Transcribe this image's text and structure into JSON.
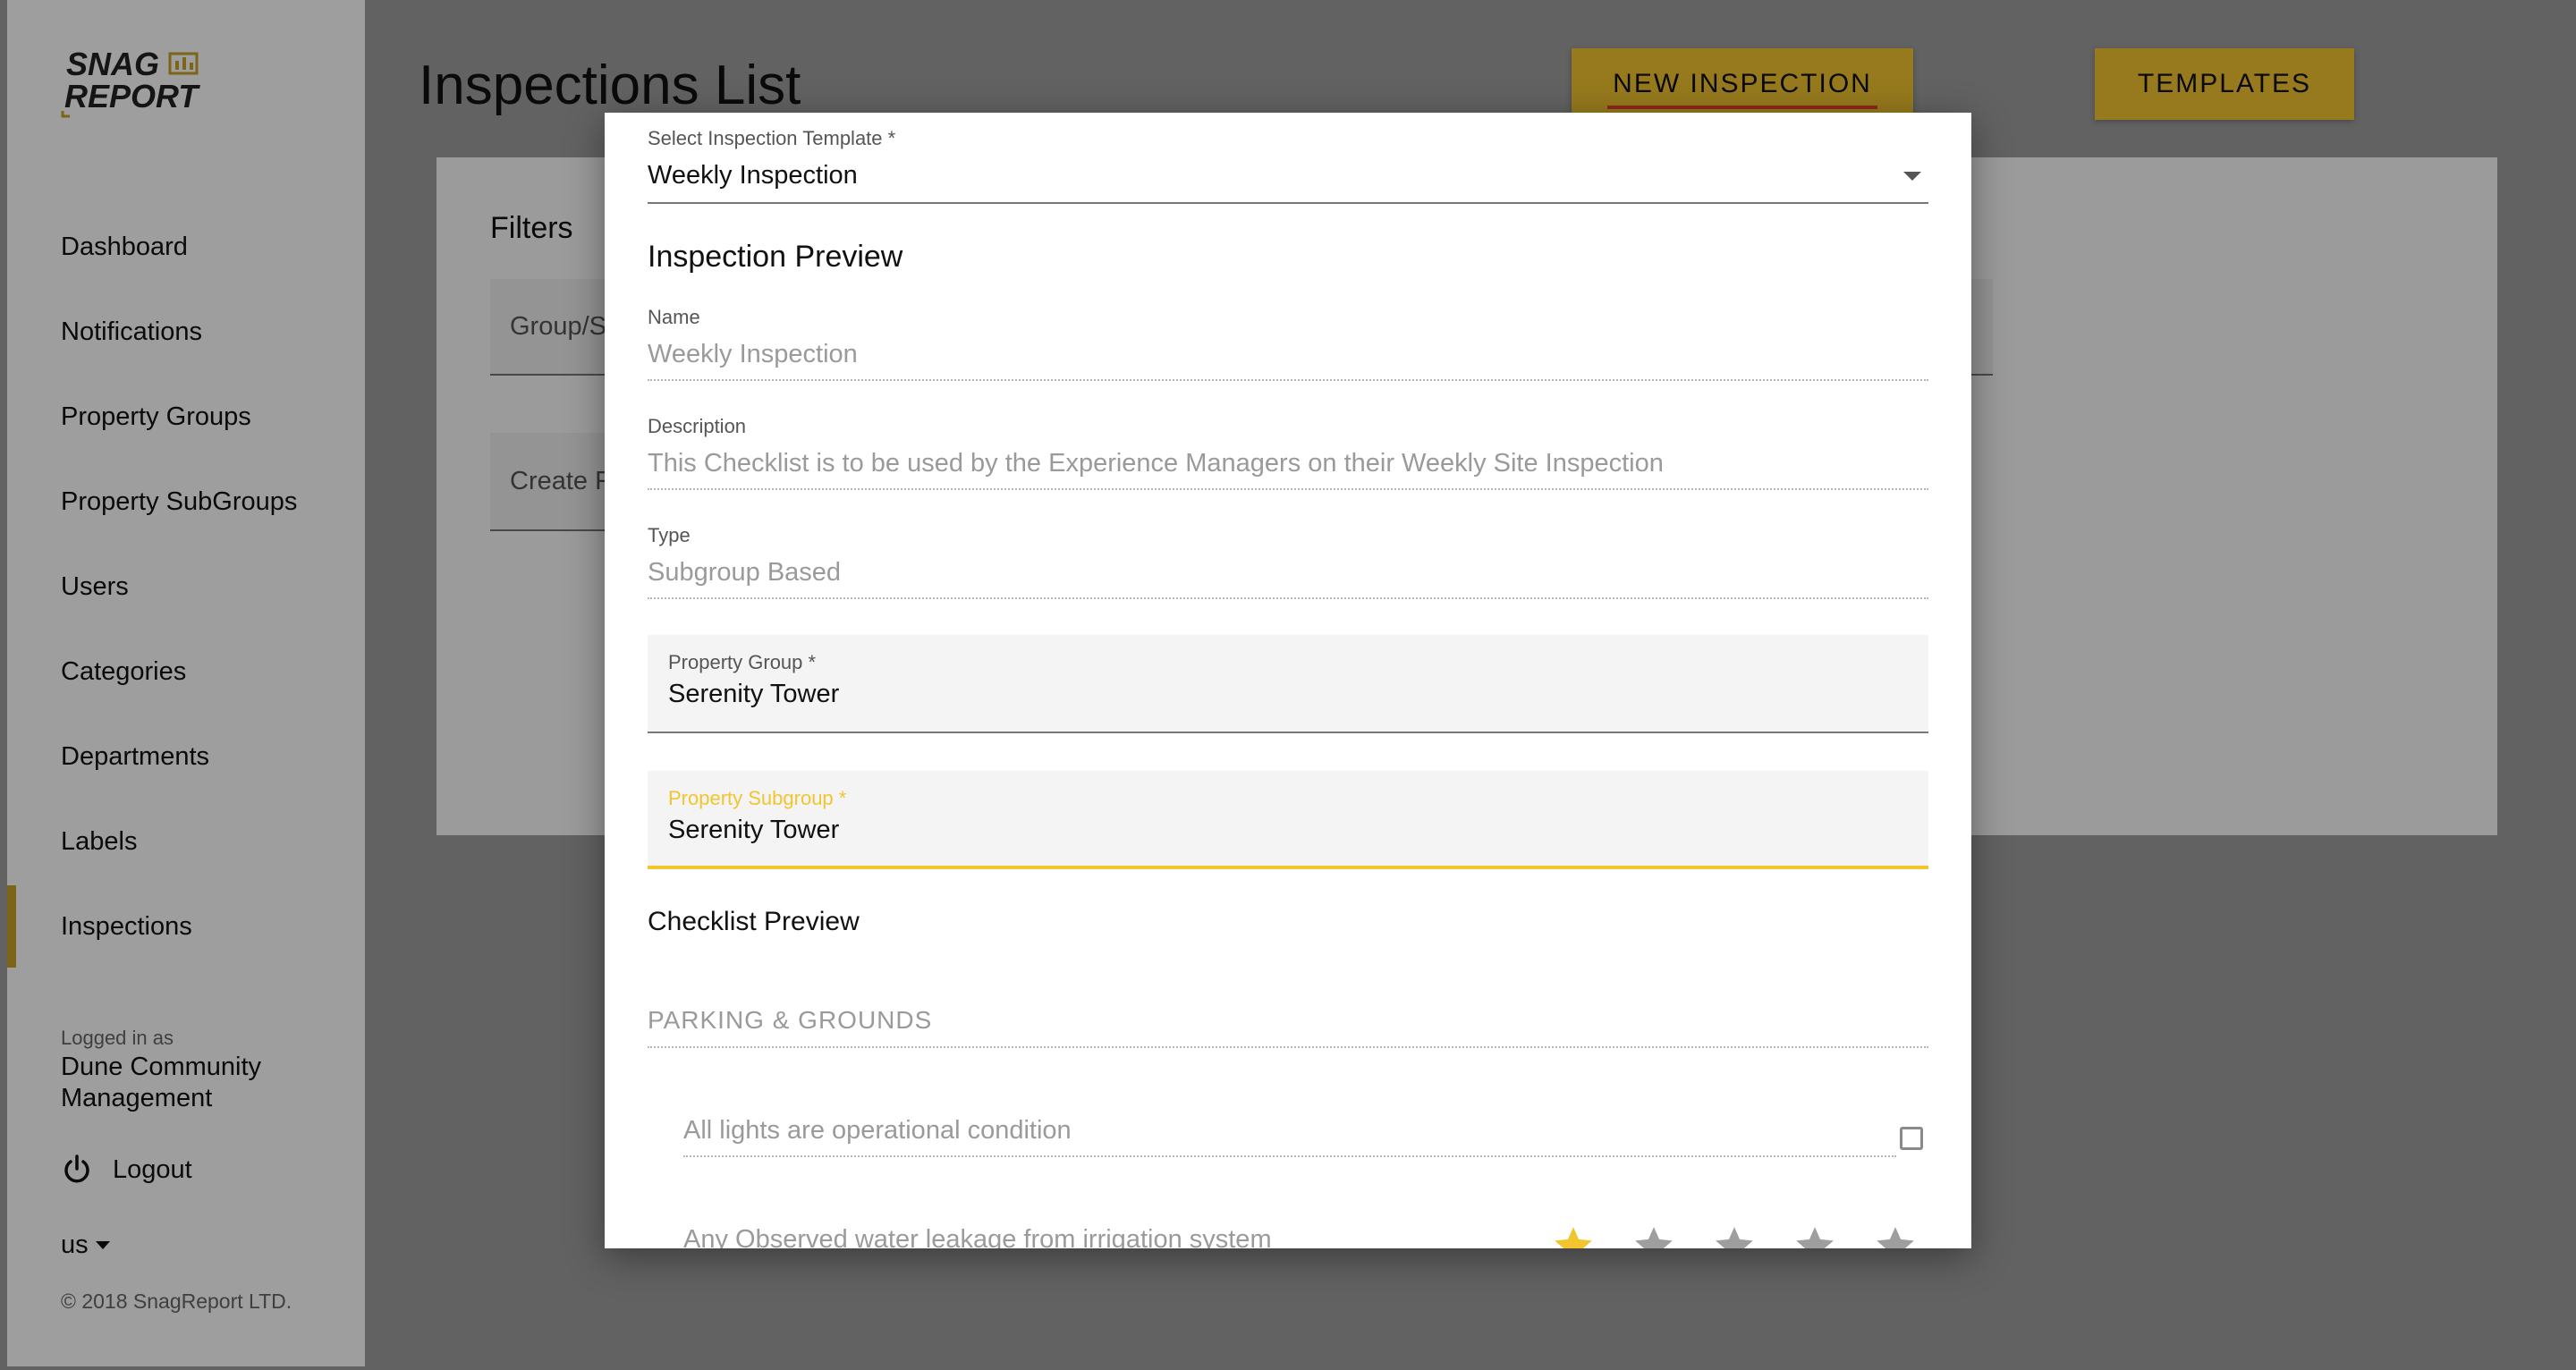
{
  "app": {
    "logo_text_top": "SNAG",
    "logo_text_bottom": "REPORT"
  },
  "sidebar": {
    "items": [
      {
        "label": "Dashboard"
      },
      {
        "label": "Notifications"
      },
      {
        "label": "Property Groups"
      },
      {
        "label": "Property SubGroups"
      },
      {
        "label": "Users"
      },
      {
        "label": "Categories"
      },
      {
        "label": "Departments"
      },
      {
        "label": "Labels"
      },
      {
        "label": "Inspections",
        "active": true
      }
    ],
    "logged_in_label": "Logged in as",
    "logged_in_name": "Dune Community Management",
    "logout_label": "Logout",
    "language": "us",
    "copyright": "© 2018 SnagReport LTD."
  },
  "header": {
    "title": "Inspections List",
    "new_inspection_label": "NEW INSPECTION",
    "templates_label": "TEMPLATES"
  },
  "filters": {
    "title": "Filters",
    "group_field_partial": "Group/S",
    "create_field_partial": "Create F"
  },
  "modal": {
    "template_select": {
      "label": "Select Inspection Template *",
      "value": "Weekly Inspection"
    },
    "preview_title": "Inspection Preview",
    "name": {
      "label": "Name",
      "value": "Weekly Inspection"
    },
    "description": {
      "label": "Description",
      "value": "This Checklist is to be used by the Experience Managers on their Weekly Site Inspection"
    },
    "type": {
      "label": "Type",
      "value": "Subgroup Based"
    },
    "property_group": {
      "label": "Property Group *",
      "value": "Serenity Tower"
    },
    "property_subgroup": {
      "label": "Property Subgroup *",
      "value": "Serenity Tower"
    },
    "checklist_title": "Checklist Preview",
    "checklist_group": "PARKING & GROUNDS",
    "checklist_items": [
      {
        "text": "All lights are operational condition",
        "kind": "checkbox",
        "checked": false
      },
      {
        "text": "Any Observed water leakage from irrigation system",
        "kind": "rating",
        "rating": 1,
        "max": 5
      }
    ]
  },
  "colors": {
    "accent": "#f2c52f",
    "active_bar": "#c9a227",
    "underline": "#e0452b"
  }
}
